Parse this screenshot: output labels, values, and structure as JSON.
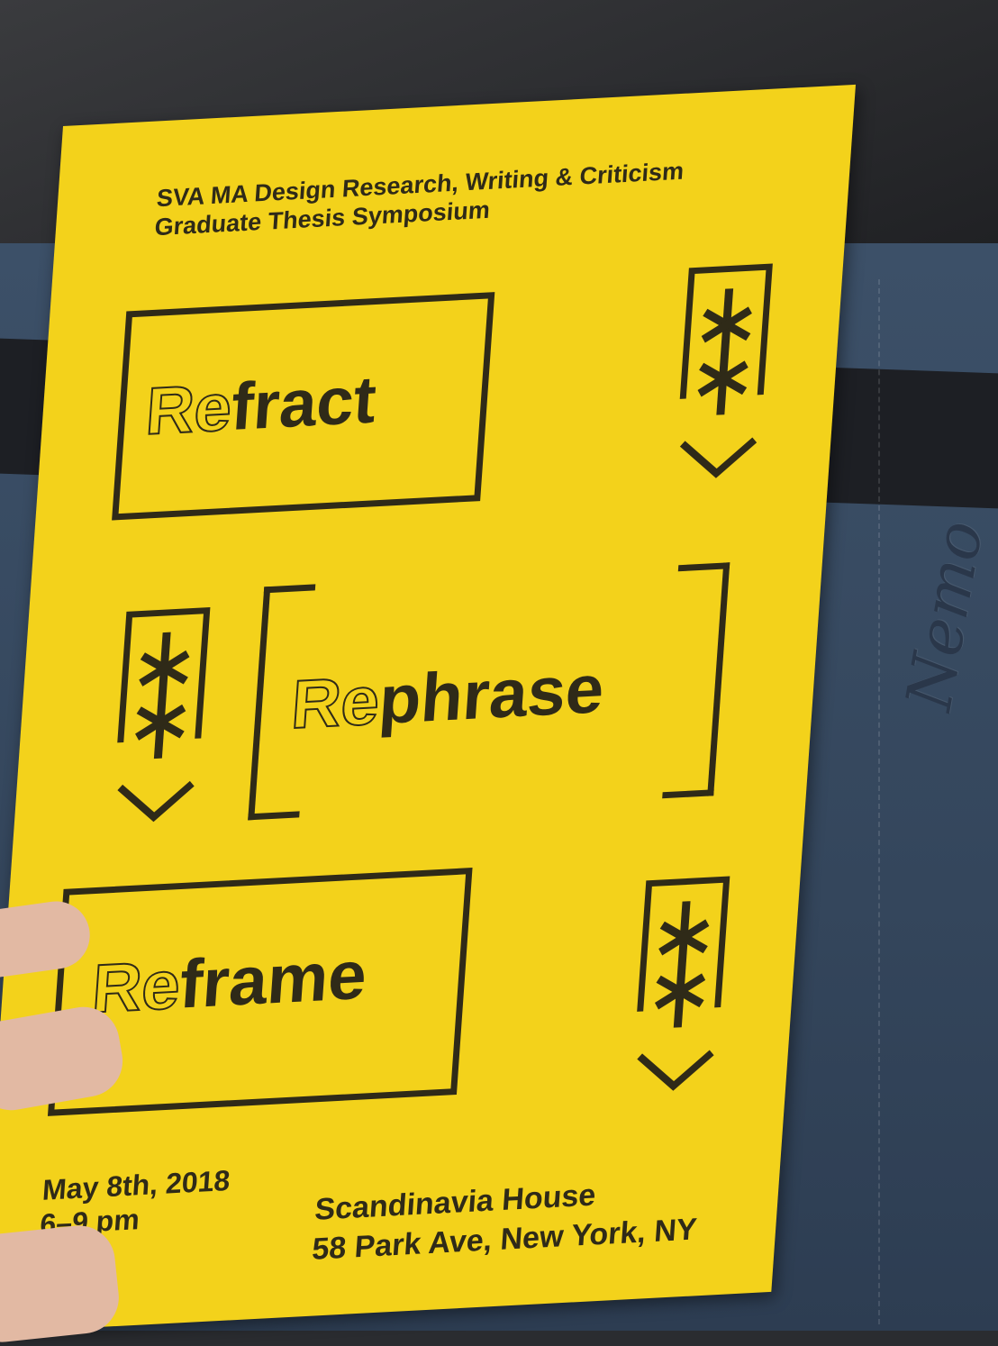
{
  "booklet": {
    "header": {
      "line1": "SVA MA Design Research, Writing & Criticism",
      "line2": "Graduate Thesis Symposium"
    },
    "words": [
      {
        "prefix": "Re",
        "rest": "fract"
      },
      {
        "prefix": "Re",
        "rest": "phrase"
      },
      {
        "prefix": "Re",
        "rest": "frame"
      }
    ],
    "date": "May 8th, 2018",
    "time": "6–9 pm",
    "venue": "Scandinavia House",
    "address": "58 Park Ave, New York, NY",
    "colors": {
      "paper": "#f3d21b",
      "ink": "#2f2a18"
    }
  }
}
